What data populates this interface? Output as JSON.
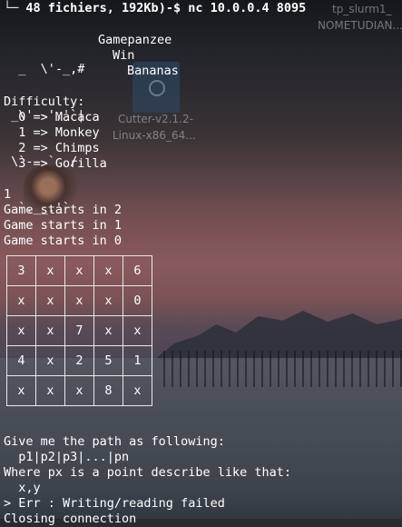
{
  "desktop": {
    "icon_name": "cutter-app-icon",
    "icon_label_1": "Cutter-v2.1.2-",
    "icon_label_2": "Linux-x86_64...",
    "top_label_1": "tp_slurm1_",
    "top_label_2": "NOMETUDIAN..."
  },
  "terminal": {
    "prompt_prefix": "48 fichiers, 192Kb)-$ ",
    "command": "nc 10.0.0.4 8095",
    "ascii_art": [
      "  _  \\'-_,#",
      " _\\'--','`|",
      " \\`---`  /",
      "  `.__.'`"
    ],
    "banner": {
      "line1": "Gamepanzee",
      "line2": "Win",
      "line3": "Bananas"
    },
    "difficulty_title": "Difficulty:",
    "difficulty_options": [
      "  0 => Macaca",
      "  1 => Monkey",
      "  2 => Chimps",
      "  3 => Gorilla"
    ],
    "input_value": "1",
    "countdown": [
      "Game starts in 2",
      "Game starts in 1",
      "Game starts in 0"
    ],
    "grid": [
      [
        "3",
        "x",
        "x",
        "x",
        "6"
      ],
      [
        "x",
        "x",
        "x",
        "x",
        "0"
      ],
      [
        "x",
        "x",
        "7",
        "x",
        "x"
      ],
      [
        "4",
        "x",
        "2",
        "5",
        "1"
      ],
      [
        "x",
        "x",
        "x",
        "8",
        "x"
      ]
    ],
    "instructions": [
      "Give me the path as following:",
      "  p1|p2|p3|...|pn",
      "Where px is a point describe like that:",
      "  x,y",
      "> Err : Writing/reading failed",
      "Closing connection"
    ]
  }
}
